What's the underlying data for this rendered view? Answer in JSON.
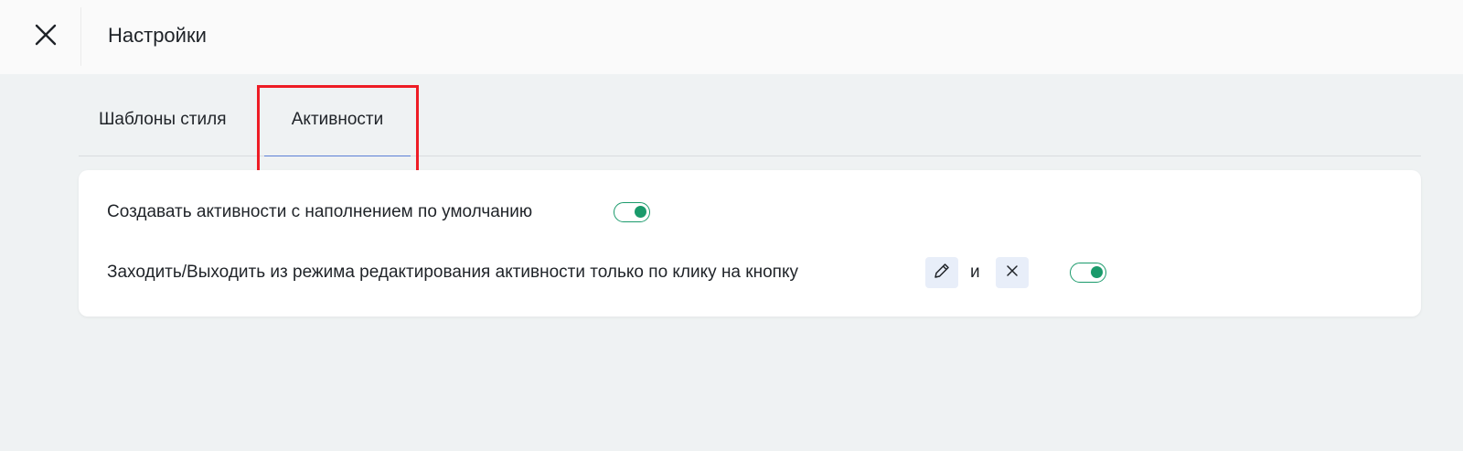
{
  "header": {
    "title": "Настройки",
    "close_icon": "close-icon"
  },
  "tabs": [
    {
      "label": "Шаблоны стиля",
      "active": false
    },
    {
      "label": "Активности",
      "active": true
    }
  ],
  "settings": [
    {
      "label": "Создавать активности с наполнением по умолчанию",
      "enabled": true
    },
    {
      "label": "Заходить/Выходить из режима редактирования активности только по клику на кнопку",
      "pencil_icon": "pencil-icon",
      "conjunction": "и",
      "close_icon": "close-icon",
      "enabled": true
    }
  ],
  "colors": {
    "toggle_on": "#1a9a6b",
    "tab_underline": "#5b7fd6",
    "highlight": "#ee1c25",
    "icon_chip_bg": "#e8eef9"
  }
}
